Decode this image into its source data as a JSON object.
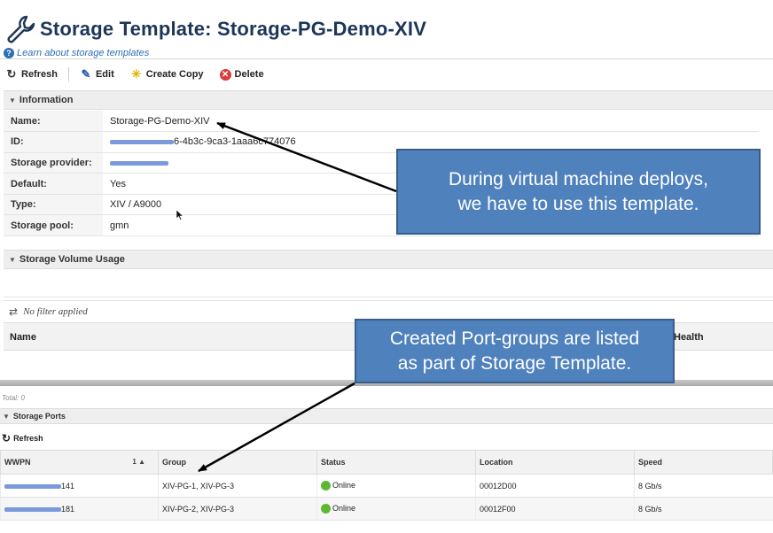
{
  "header": {
    "title": "Storage Template: Storage-PG-Demo-XIV",
    "help_link": "Learn about storage templates"
  },
  "toolbar": {
    "refresh_label": "Refresh",
    "edit_label": "Edit",
    "create_copy_label": "Create Copy",
    "delete_label": "Delete"
  },
  "information": {
    "section_title": "Information",
    "fields": [
      {
        "label": "Name:",
        "value": "Storage-PG-Demo-XIV"
      },
      {
        "label": "ID:",
        "value": "6-4b3c-9ca3-1aaa6c774076"
      },
      {
        "label": "Storage provider:",
        "value": ""
      },
      {
        "label": "Default:",
        "value": "Yes"
      },
      {
        "label": "Type:",
        "value": "XIV / A9000"
      },
      {
        "label": "Storage pool:",
        "value": "gmn"
      }
    ]
  },
  "volume_usage": {
    "section_title": "Storage Volume Usage",
    "filter_text": "No filter applied",
    "col_name": "Name",
    "col_health": "Health",
    "total": "Total: 0"
  },
  "storage_ports": {
    "section_title": "Storage Ports",
    "refresh_label": "Refresh",
    "columns": [
      "WWPN",
      "Group",
      "Status",
      "Location",
      "Speed"
    ],
    "sort_indicator": "1 ▲",
    "rows": [
      {
        "wwpn_suffix": "141",
        "group": "XIV-PG-1, XIV-PG-3",
        "status": "Online",
        "location": "00012D00",
        "speed": "8 Gb/s"
      },
      {
        "wwpn_suffix": "181",
        "group": "XIV-PG-2, XIV-PG-3",
        "status": "Online",
        "location": "00012F00",
        "speed": "8 Gb/s"
      }
    ]
  },
  "callouts": {
    "deploy_line1": "During virtual machine deploys,",
    "deploy_line2": "we have to use this template.",
    "portgroups_line1": "Created Port-groups are listed",
    "portgroups_line2": "as part of Storage Template."
  },
  "colors": {
    "callout_fill": "#4f81bd",
    "callout_border": "#385d8a",
    "title_color": "#1d3557",
    "status_online": "#5cb833",
    "redaction": "#6b8fd8"
  },
  "icons": {
    "title": "wrench-icon",
    "help": "help-icon",
    "refresh": "refresh-icon",
    "edit": "pencil-icon",
    "create_copy": "sparkle-icon",
    "delete": "delete-icon",
    "filter": "filter-icon",
    "status": "status-online-icon"
  }
}
